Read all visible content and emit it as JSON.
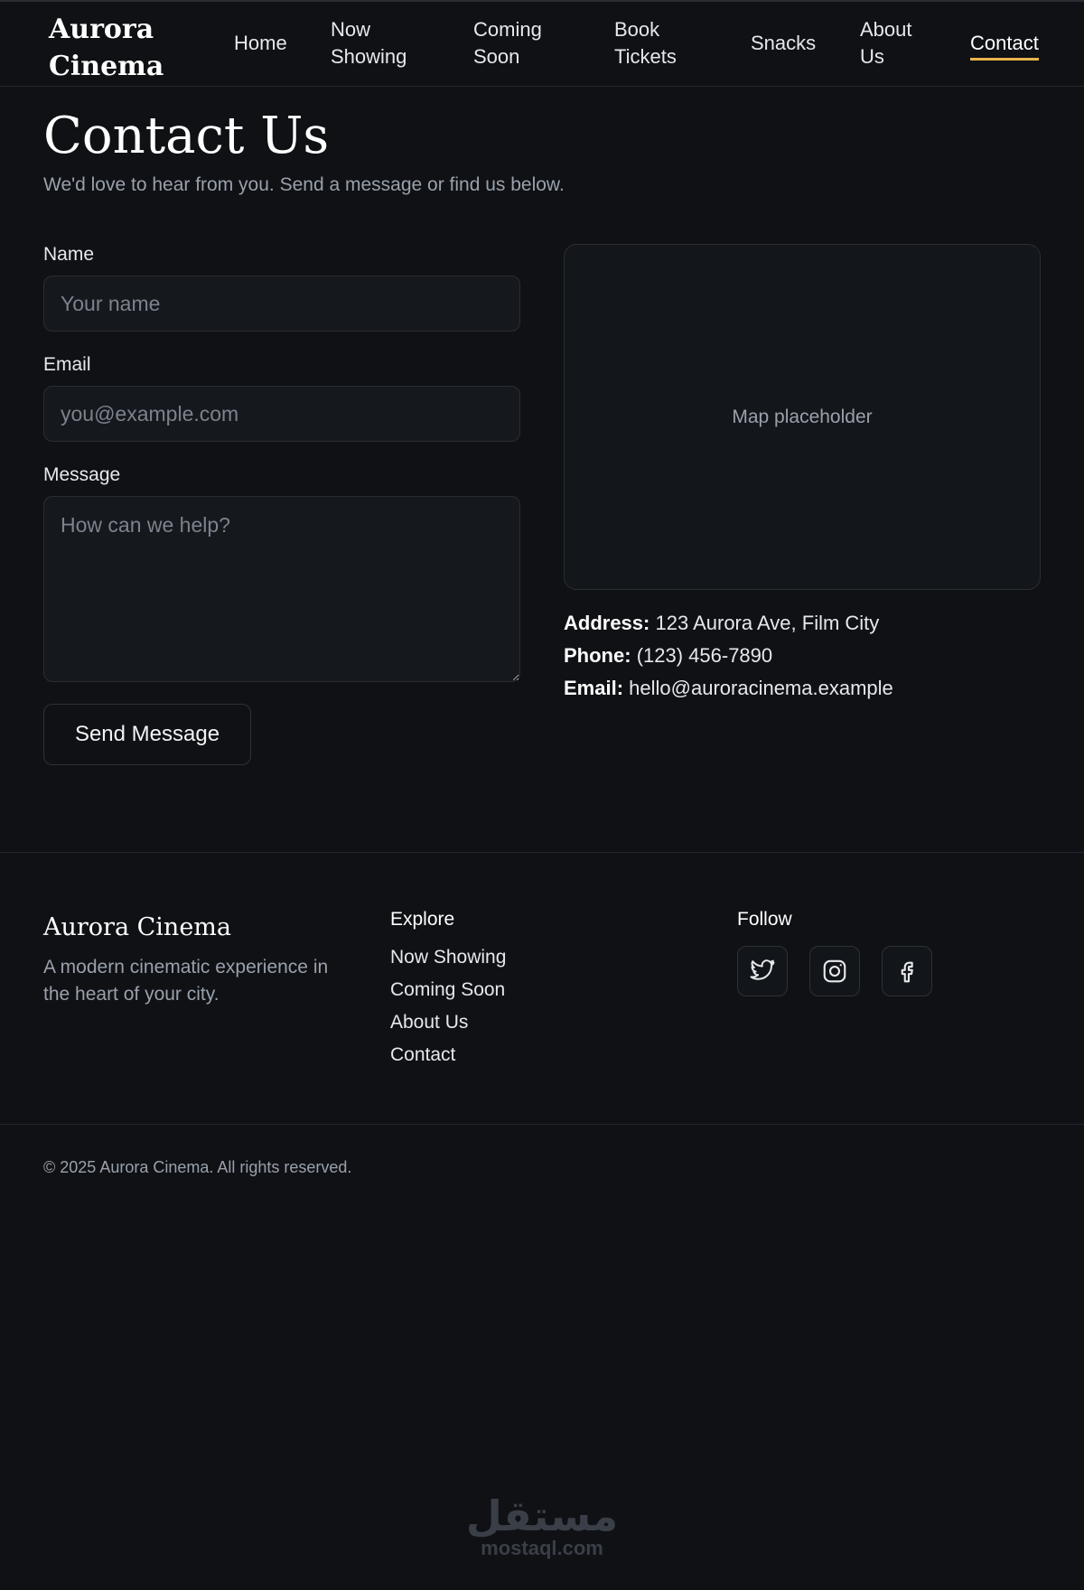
{
  "header": {
    "brand": "Aurora Cinema",
    "nav": [
      {
        "label": "Home"
      },
      {
        "label": "Now Showing"
      },
      {
        "label": "Coming Soon"
      },
      {
        "label": "Book Tickets"
      },
      {
        "label": "Snacks"
      },
      {
        "label": "About Us"
      },
      {
        "label": "Contact",
        "active": true
      }
    ],
    "active_underline_color": "#e8b54a"
  },
  "main": {
    "title": "Contact Us",
    "subtitle": "We'd love to hear from you. Send a message or find us below.",
    "form": {
      "name_label": "Name",
      "name_placeholder": "Your name",
      "email_label": "Email",
      "email_placeholder": "you@example.com",
      "message_label": "Message",
      "message_placeholder": "How can we help?",
      "submit_label": "Send Message"
    },
    "map_label": "Map placeholder",
    "contact_info": {
      "address_label": "Address:",
      "address_value": "123 Aurora Ave, Film City",
      "phone_label": "Phone:",
      "phone_value": "(123) 456-7890",
      "email_label": "Email:",
      "email_value": "hello@auroracinema.example"
    }
  },
  "footer": {
    "brand": "Aurora Cinema",
    "tagline": "A modern cinematic experience in the heart of your city.",
    "explore_heading": "Explore",
    "explore_links": [
      {
        "label": "Now Showing"
      },
      {
        "label": "Coming Soon"
      },
      {
        "label": "About Us"
      },
      {
        "label": "Contact"
      }
    ],
    "follow_heading": "Follow",
    "social_icons": [
      "twitter-icon",
      "instagram-icon",
      "facebook-icon"
    ],
    "copyright": "© 2025 Aurora Cinema. All rights reserved."
  },
  "watermark": {
    "arabic": "مستقل",
    "latin": "mostaql.com"
  }
}
